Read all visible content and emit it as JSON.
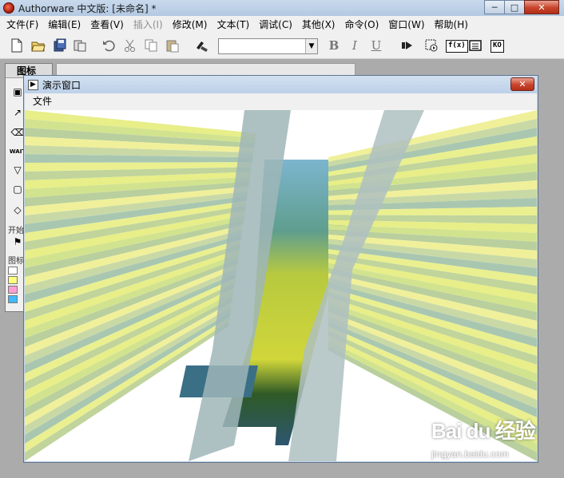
{
  "app": {
    "title": "Authorware 中文版: [未命名] *"
  },
  "window_controls": {
    "minimize": "─",
    "maximize": "□",
    "close": "✕"
  },
  "menubar": {
    "items": [
      {
        "label": "文件(F)",
        "enabled": true
      },
      {
        "label": "编辑(E)",
        "enabled": true
      },
      {
        "label": "查看(V)",
        "enabled": true
      },
      {
        "label": "插入(I)",
        "enabled": false
      },
      {
        "label": "修改(M)",
        "enabled": true
      },
      {
        "label": "文本(T)",
        "enabled": true
      },
      {
        "label": "调试(C)",
        "enabled": true
      },
      {
        "label": "其他(X)",
        "enabled": true
      },
      {
        "label": "命令(O)",
        "enabled": true
      },
      {
        "label": "窗口(W)",
        "enabled": true
      },
      {
        "label": "帮助(H)",
        "enabled": true
      }
    ]
  },
  "toolbar": {
    "style_select_value": "",
    "bold": "B",
    "italic": "I",
    "underline": "U",
    "functions_label": "f(x)",
    "knowledge_label": "KO"
  },
  "icon_palette": {
    "title": "图标",
    "start_label": "开始",
    "color_label": "图标色彩",
    "swatch_colors": [
      "#ffffff",
      "#ffff80",
      "#ff9ed2",
      "#3fb9ff",
      "#c0c0c0",
      "#c0c0c0"
    ]
  },
  "presentation_window": {
    "title": "演示窗口",
    "close": "✕",
    "menu": {
      "file": "文件"
    }
  },
  "watermark": {
    "logo": "Bai du 经验",
    "url": "jingyan.baidu.com"
  },
  "colors": {
    "ray_palette": [
      "#e8ee88",
      "#d2e38f",
      "#b9cf9e",
      "#f0f09a",
      "#c9d9a6",
      "#a9c7b0",
      "#eaf08f",
      "#c0d49c"
    ],
    "landscape_sky": "#7cb5ce",
    "landscape_field": "#d0d63a"
  }
}
